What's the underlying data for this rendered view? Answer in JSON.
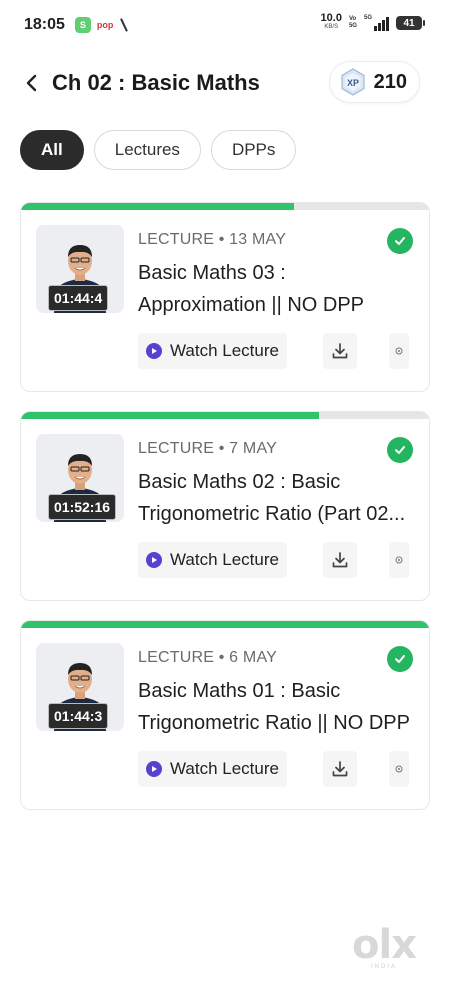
{
  "status_bar": {
    "time": "18:05",
    "app_badge_text": "S",
    "pop_text": "pop",
    "net_speed_value": "10.0",
    "net_speed_unit": "KB/S",
    "vo_top": "Vo",
    "vo_bottom": "5G",
    "signal_label": "5G",
    "battery_level": "41"
  },
  "header": {
    "title": "Ch 02 : Basic Maths",
    "xp_label": "XP",
    "xp_count": "210",
    "icons": {
      "back": "back-arrow-icon",
      "xp": "xp-hexagon-icon"
    }
  },
  "filters": [
    {
      "label": "All",
      "active": true
    },
    {
      "label": "Lectures",
      "active": false
    },
    {
      "label": "DPPs",
      "active": false
    }
  ],
  "lectures": [
    {
      "meta": "LECTURE • 13 MAY",
      "title": "Basic Maths 03 : Approximation || NO DPP",
      "duration": "01:44:4",
      "progress": 0.67,
      "completed": true,
      "watch_label": "Watch Lecture"
    },
    {
      "meta": "LECTURE • 7 MAY",
      "title": "Basic Maths 02 : Basic Trigonometric Ratio (Part 02...",
      "duration": "01:52:16",
      "progress": 0.73,
      "completed": true,
      "watch_label": "Watch Lecture"
    },
    {
      "meta": "LECTURE • 6 MAY",
      "title": "Basic Maths 01 : Basic Trigonometric Ratio || NO DPP",
      "duration": "01:44:3",
      "progress": 1.0,
      "completed": true,
      "watch_label": "Watch Lecture"
    }
  ],
  "colors": {
    "accent_green": "#2fc46b",
    "check_green": "#24b561",
    "play_purple": "#5a3fd1",
    "chip_active": "#2b2b2b"
  },
  "watermark": {
    "logo": "olx",
    "sub": "INDIA"
  }
}
